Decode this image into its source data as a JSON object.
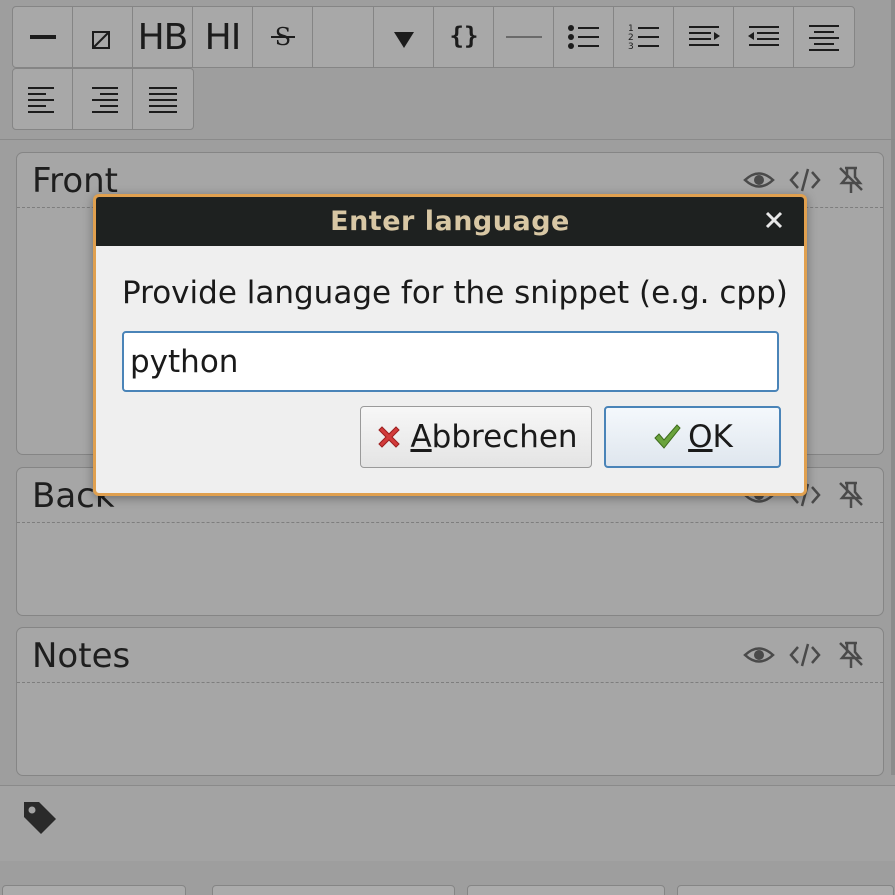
{
  "toolbar": {
    "hb_label": "HB",
    "hi_label": "HI"
  },
  "fields": [
    {
      "label": "Front"
    },
    {
      "label": "Back"
    },
    {
      "label": "Notes"
    }
  ],
  "dialog": {
    "title": "Enter language",
    "close_glyph": "×",
    "prompt": "Provide language for the snippet (e.g. cpp)",
    "input_value": "python",
    "cancel_mnemonic": "A",
    "cancel_rest": "bbrechen",
    "ok_mnemonic": "O",
    "ok_rest": "K"
  },
  "colors": {
    "titlebar": "#1e2120",
    "title_text": "#d8c7a4",
    "dialog_border": "#e0a04f",
    "focus_blue": "#4a84b8",
    "cancel_red": "#d23b3b",
    "ok_green": "#6aa33c"
  },
  "icons": {
    "cancel": "red-x-icon",
    "ok": "green-check-icon",
    "field_preview": "eye-icon",
    "field_html": "code-icon",
    "field_pin": "pin-icon",
    "tags": "tag-icon"
  }
}
